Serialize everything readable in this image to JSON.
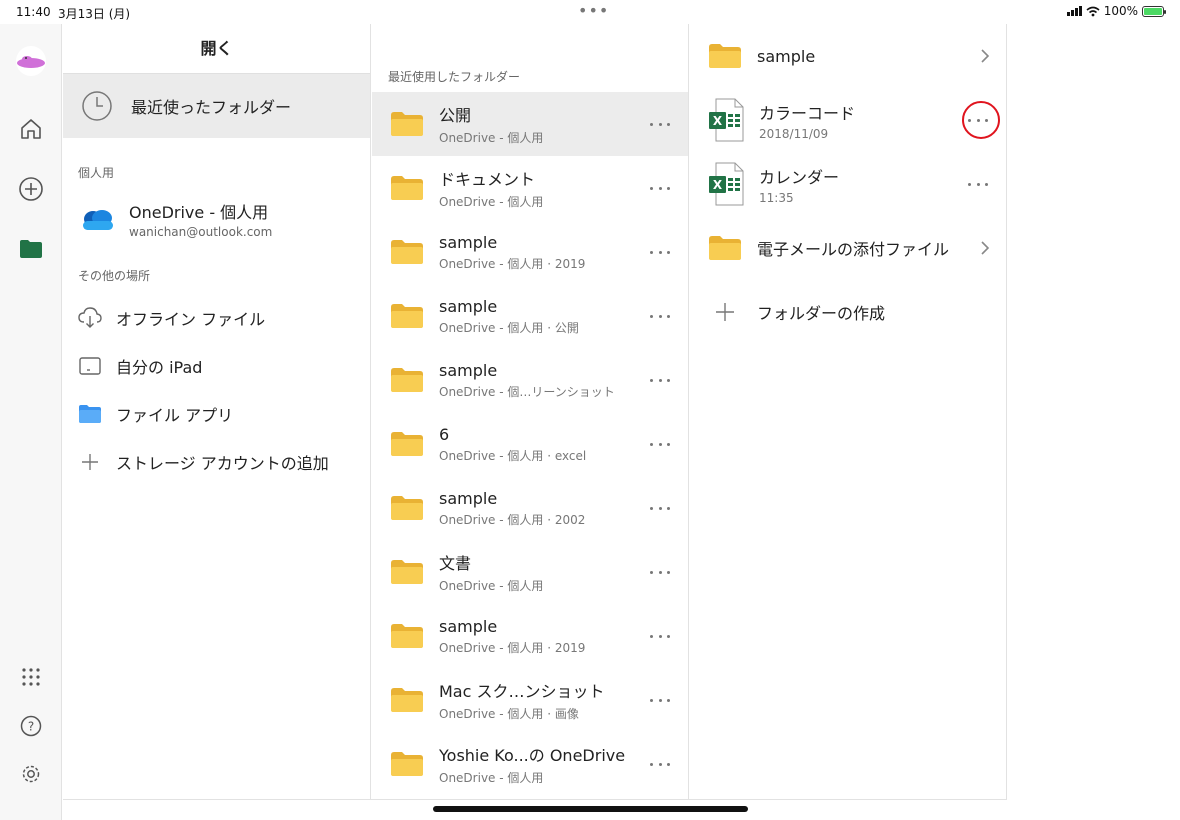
{
  "status_bar": {
    "time": "11:40",
    "date": "3月13日 (月)",
    "battery": "100%"
  },
  "rail": {
    "icons": [
      "app-avatar-icon",
      "home-icon",
      "add-circle-icon",
      "folder-icon",
      "apps-grid-icon",
      "help-icon",
      "settings-icon"
    ]
  },
  "pane1": {
    "title": "開く",
    "recent_label": "最近使ったフォルダー",
    "personal_section": "個人用",
    "account": {
      "name": "OneDrive - 個人用",
      "email": "wanichan@outlook.com"
    },
    "other_section": "その他の場所",
    "locations": [
      {
        "label": "オフライン ファイル",
        "icon": "cloud-download-icon"
      },
      {
        "label": "自分の iPad",
        "icon": "ipad-icon"
      },
      {
        "label": "ファイル アプリ",
        "icon": "files-app-icon"
      },
      {
        "label": "ストレージ アカウントの追加",
        "icon": "plus-icon"
      }
    ]
  },
  "pane2": {
    "section_label": "最近使用したフォルダー",
    "folders": [
      {
        "name": "公開",
        "sub": "OneDrive - 個人用"
      },
      {
        "name": "ドキュメント",
        "sub": "OneDrive - 個人用"
      },
      {
        "name": "sample",
        "sub": "OneDrive - 個人用 · 2019"
      },
      {
        "name": "sample",
        "sub": "OneDrive - 個人用 · 公開"
      },
      {
        "name": "sample",
        "sub": "OneDrive - 個…リーンショット"
      },
      {
        "name": "6",
        "sub": "OneDrive - 個人用 · excel"
      },
      {
        "name": "sample",
        "sub": "OneDrive - 個人用 · 2002"
      },
      {
        "name": "文書",
        "sub": "OneDrive - 個人用"
      },
      {
        "name": "sample",
        "sub": "OneDrive - 個人用 · 2019"
      },
      {
        "name": "Mac スク…ンショット",
        "sub": "OneDrive - 個人用 · 画像"
      },
      {
        "name": "Yoshie Ko...の OneDrive",
        "sub": "OneDrive - 個人用"
      }
    ]
  },
  "pane3": {
    "items": [
      {
        "type": "folder",
        "name": "sample"
      },
      {
        "type": "excel",
        "name": "カラーコード",
        "sub": "2018/11/09"
      },
      {
        "type": "excel",
        "name": "カレンダー",
        "sub": "11:35"
      },
      {
        "type": "folder",
        "name": "電子メールの添付ファイル"
      }
    ],
    "create_folder": "フォルダーの作成"
  },
  "colors": {
    "folder": "#f7c948",
    "excel": "#217346",
    "onedrive": "#1f7bd8",
    "highlight_circle": "#e0141e"
  }
}
